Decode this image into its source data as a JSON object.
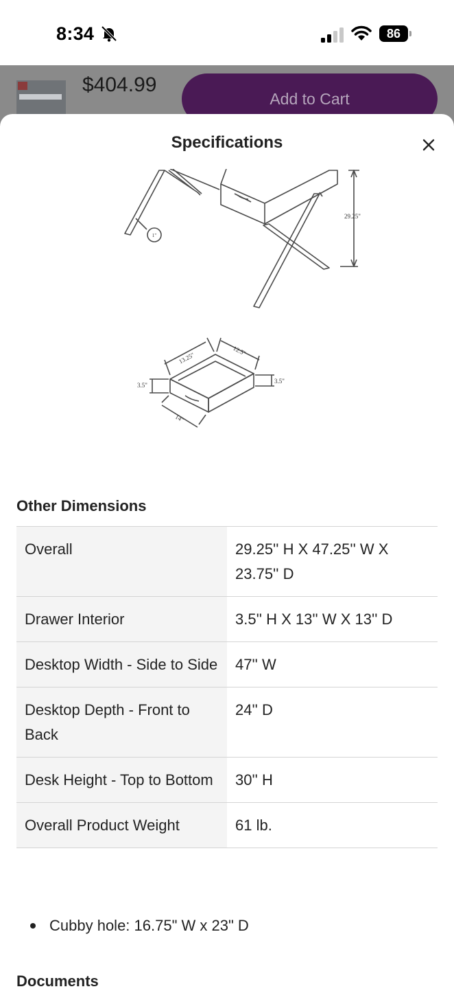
{
  "status_bar": {
    "time": "8:34",
    "battery": "86"
  },
  "purchase_bar": {
    "price": "$404.99",
    "add_to_cart_label": "Add to Cart",
    "accent_color": "#4a1a55"
  },
  "sheet": {
    "title": "Specifications",
    "drawing": {
      "desk_height_label": "29.25\"",
      "leg_label": "1\"",
      "drawer_labels": {
        "back_width": "13.25\"",
        "depth": "12.5\"",
        "left_height": "3.5\"",
        "right_height": "3.5\"",
        "front_width": "14\""
      }
    },
    "other_dimensions_title": "Other Dimensions",
    "dimensions": [
      {
        "label": "Overall",
        "value": "29.25'' H X 47.25'' W X 23.75'' D"
      },
      {
        "label": "Drawer Interior",
        "value": "3.5'' H X 13'' W X 13'' D"
      },
      {
        "label": "Desktop Width - Side to Side",
        "value": "47'' W"
      },
      {
        "label": "Desktop Depth - Front to Back",
        "value": "24'' D"
      },
      {
        "label": "Desk Height - Top to Bottom",
        "value": "30'' H"
      },
      {
        "label": "Overall Product Weight",
        "value": "61 lb."
      }
    ],
    "bullets": [
      "Cubby hole: 16.75\" W x 23\" D"
    ],
    "documents_title": "Documents"
  }
}
